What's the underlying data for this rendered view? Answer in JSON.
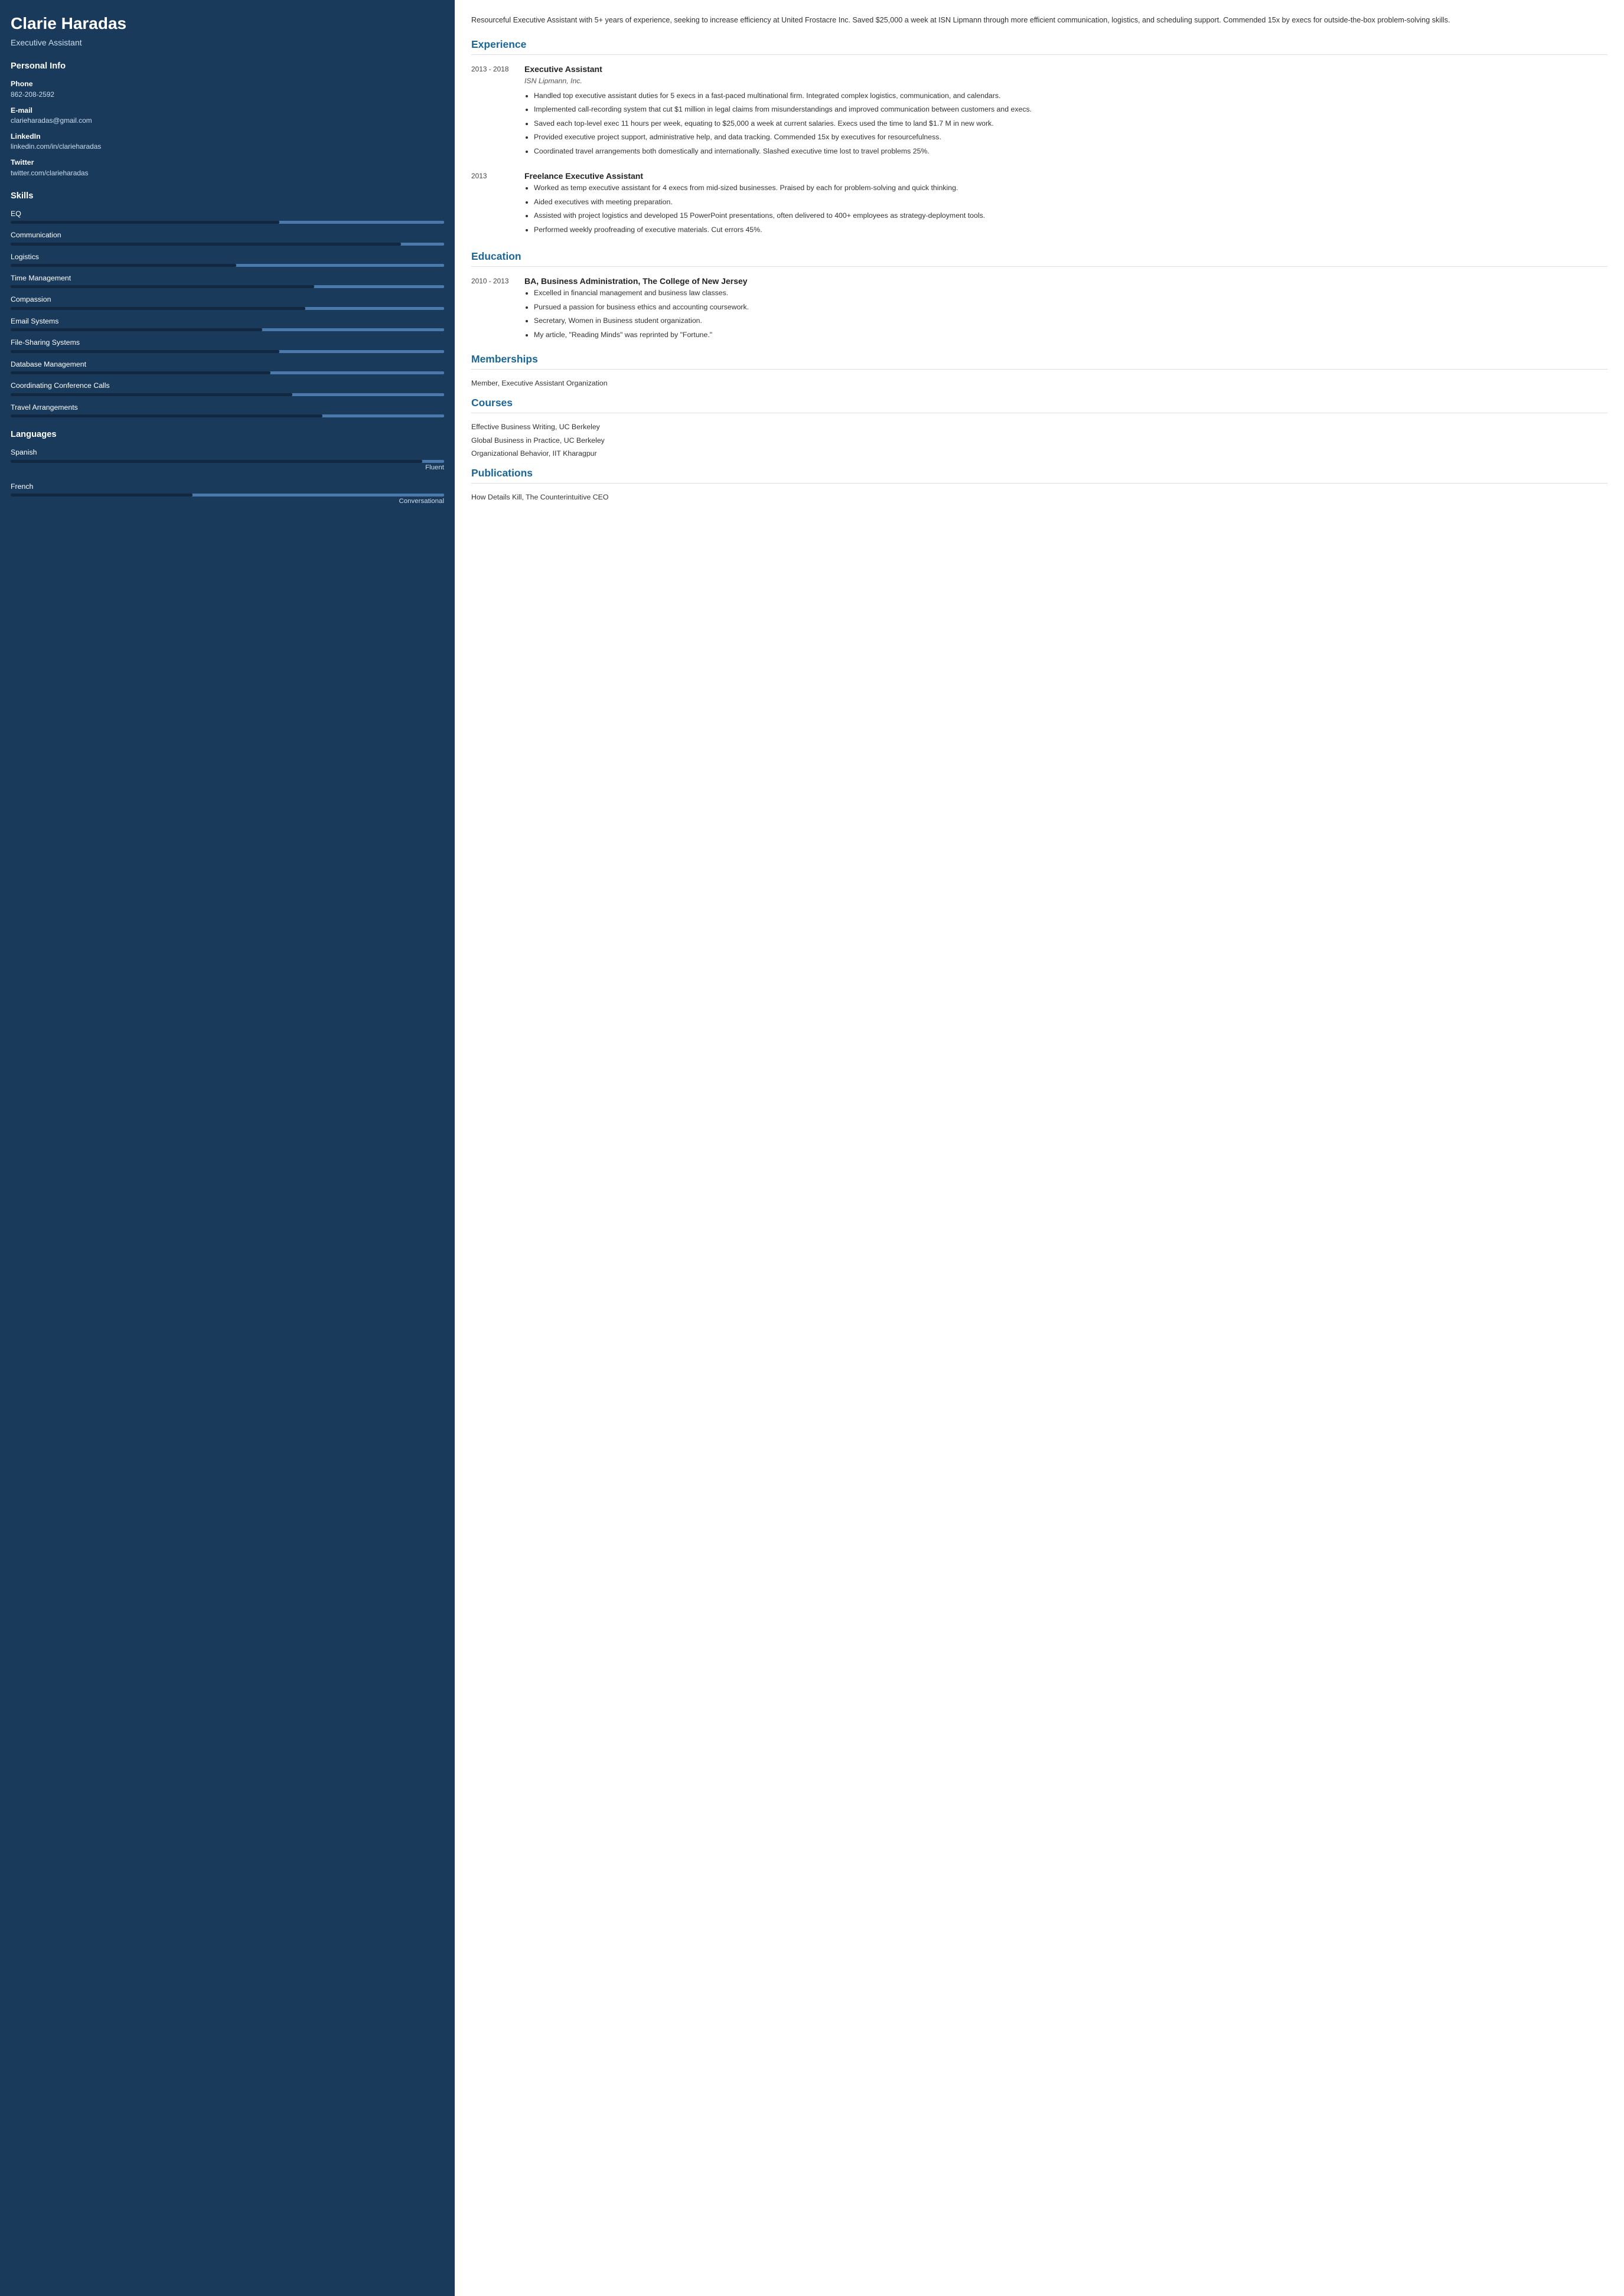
{
  "sidebar": {
    "name": "Clarie Haradas",
    "title": "Executive Assistant",
    "personal_info": {
      "label": "Personal Info",
      "phone_label": "Phone",
      "phone": "862-208-2592",
      "email_label": "E-mail",
      "email": "clarieharadas@gmail.com",
      "linkedin_label": "LinkedIn",
      "linkedin": "linkedin.com/in/clarieharadas",
      "twitter_label": "Twitter",
      "twitter": "twitter.com/clarieharadas"
    },
    "skills": {
      "label": "Skills",
      "items": [
        {
          "name": "EQ",
          "pct": 62
        },
        {
          "name": "Communication",
          "pct": 90
        },
        {
          "name": "Logistics",
          "pct": 52
        },
        {
          "name": "Time Management",
          "pct": 70
        },
        {
          "name": "Compassion",
          "pct": 68
        },
        {
          "name": "Email Systems",
          "pct": 58
        },
        {
          "name": "File-Sharing Systems",
          "pct": 62
        },
        {
          "name": "Database Management",
          "pct": 60
        },
        {
          "name": "Coordinating Conference Calls",
          "pct": 65
        },
        {
          "name": "Travel Arrangements",
          "pct": 72
        }
      ]
    },
    "languages": {
      "label": "Languages",
      "items": [
        {
          "name": "Spanish",
          "bar_pct": 95,
          "level": "Fluent"
        },
        {
          "name": "French",
          "bar_pct": 42,
          "level": "Conversational"
        }
      ]
    }
  },
  "main": {
    "summary": "Resourceful Executive Assistant with 5+ years of experience, seeking to increase efficiency at United Frostacre Inc. Saved $25,000 a week at ISN Lipmann through more efficient communication, logistics, and scheduling support. Commended 15x by execs for outside-the-box problem-solving skills.",
    "experience": {
      "label": "Experience",
      "entries": [
        {
          "date": "2013 - 2018",
          "title": "Executive Assistant",
          "company": "ISN Lipmann, Inc.",
          "bullets": [
            "Handled top executive assistant duties for 5 execs in a fast-paced multinational firm. Integrated complex logistics, communication, and calendars.",
            "Implemented call-recording system that cut $1 million in legal claims from misunderstandings and improved communication between customers and execs.",
            "Saved each top-level exec 11 hours per week, equating to $25,000 a week at current salaries. Execs used the time to land $1.7 M in new work.",
            "Provided executive project support, administrative help, and data tracking. Commended 15x by executives for resourcefulness.",
            "Coordinated travel arrangements both domestically and internationally. Slashed executive time lost to travel problems 25%."
          ]
        },
        {
          "date": "2013",
          "title": "Freelance Executive Assistant",
          "company": "",
          "bullets": [
            "Worked as temp executive assistant for 4 execs from mid-sized businesses. Praised by each for problem-solving and quick thinking.",
            "Aided executives with meeting preparation.",
            "Assisted with project logistics and developed 15 PowerPoint presentations, often delivered to 400+ employees as strategy-deployment tools.",
            "Performed weekly proofreading of executive materials. Cut errors 45%."
          ]
        }
      ]
    },
    "education": {
      "label": "Education",
      "entries": [
        {
          "date": "2010 - 2013",
          "title": "BA, Business Administration, The College of New Jersey",
          "company": "",
          "bullets": [
            "Excelled in financial management and business law classes.",
            "Pursued a passion for business ethics and accounting coursework.",
            "Secretary, Women in Business student organization.",
            "My article, \"Reading Minds\" was reprinted by \"Fortune.\""
          ]
        }
      ]
    },
    "memberships": {
      "label": "Memberships",
      "items": [
        "Member, Executive Assistant Organization"
      ]
    },
    "courses": {
      "label": "Courses",
      "items": [
        "Effective Business Writing, UC Berkeley",
        "Global Business in Practice, UC Berkeley",
        "Organizational Behavior, IIT Kharagpur"
      ]
    },
    "publications": {
      "label": "Publications",
      "items": [
        "How Details Kill, The Counterintuitive CEO"
      ]
    }
  }
}
